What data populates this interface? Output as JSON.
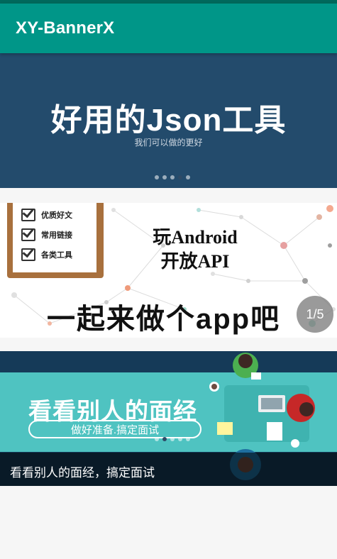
{
  "app": {
    "title": "XY-BannerX"
  },
  "banners": [
    {
      "title": "好用的Json工具",
      "subtitle": "我们可以做的更好",
      "indicator_dots": 5,
      "active_dot": 3
    },
    {
      "checklist": [
        "优质好文",
        "常用链接",
        "各类工具"
      ],
      "title_line1": "玩Android",
      "title_line2": "开放API",
      "slogan": "一起来做个app吧",
      "page_indicator": "1/5"
    },
    {
      "title": "看看别人的面经",
      "pill_text": "做好准备.搞定面试",
      "caption": "看看别人的面经，搞定面试",
      "indicator_dots": 5,
      "active_dot": 1
    }
  ],
  "colors": {
    "primary": "#009688",
    "primary_dark": "#00695c",
    "banner1_bg": "#234b6c",
    "banner3_stripe": "#4fc3c1",
    "banner3_bg": "#153a58"
  }
}
